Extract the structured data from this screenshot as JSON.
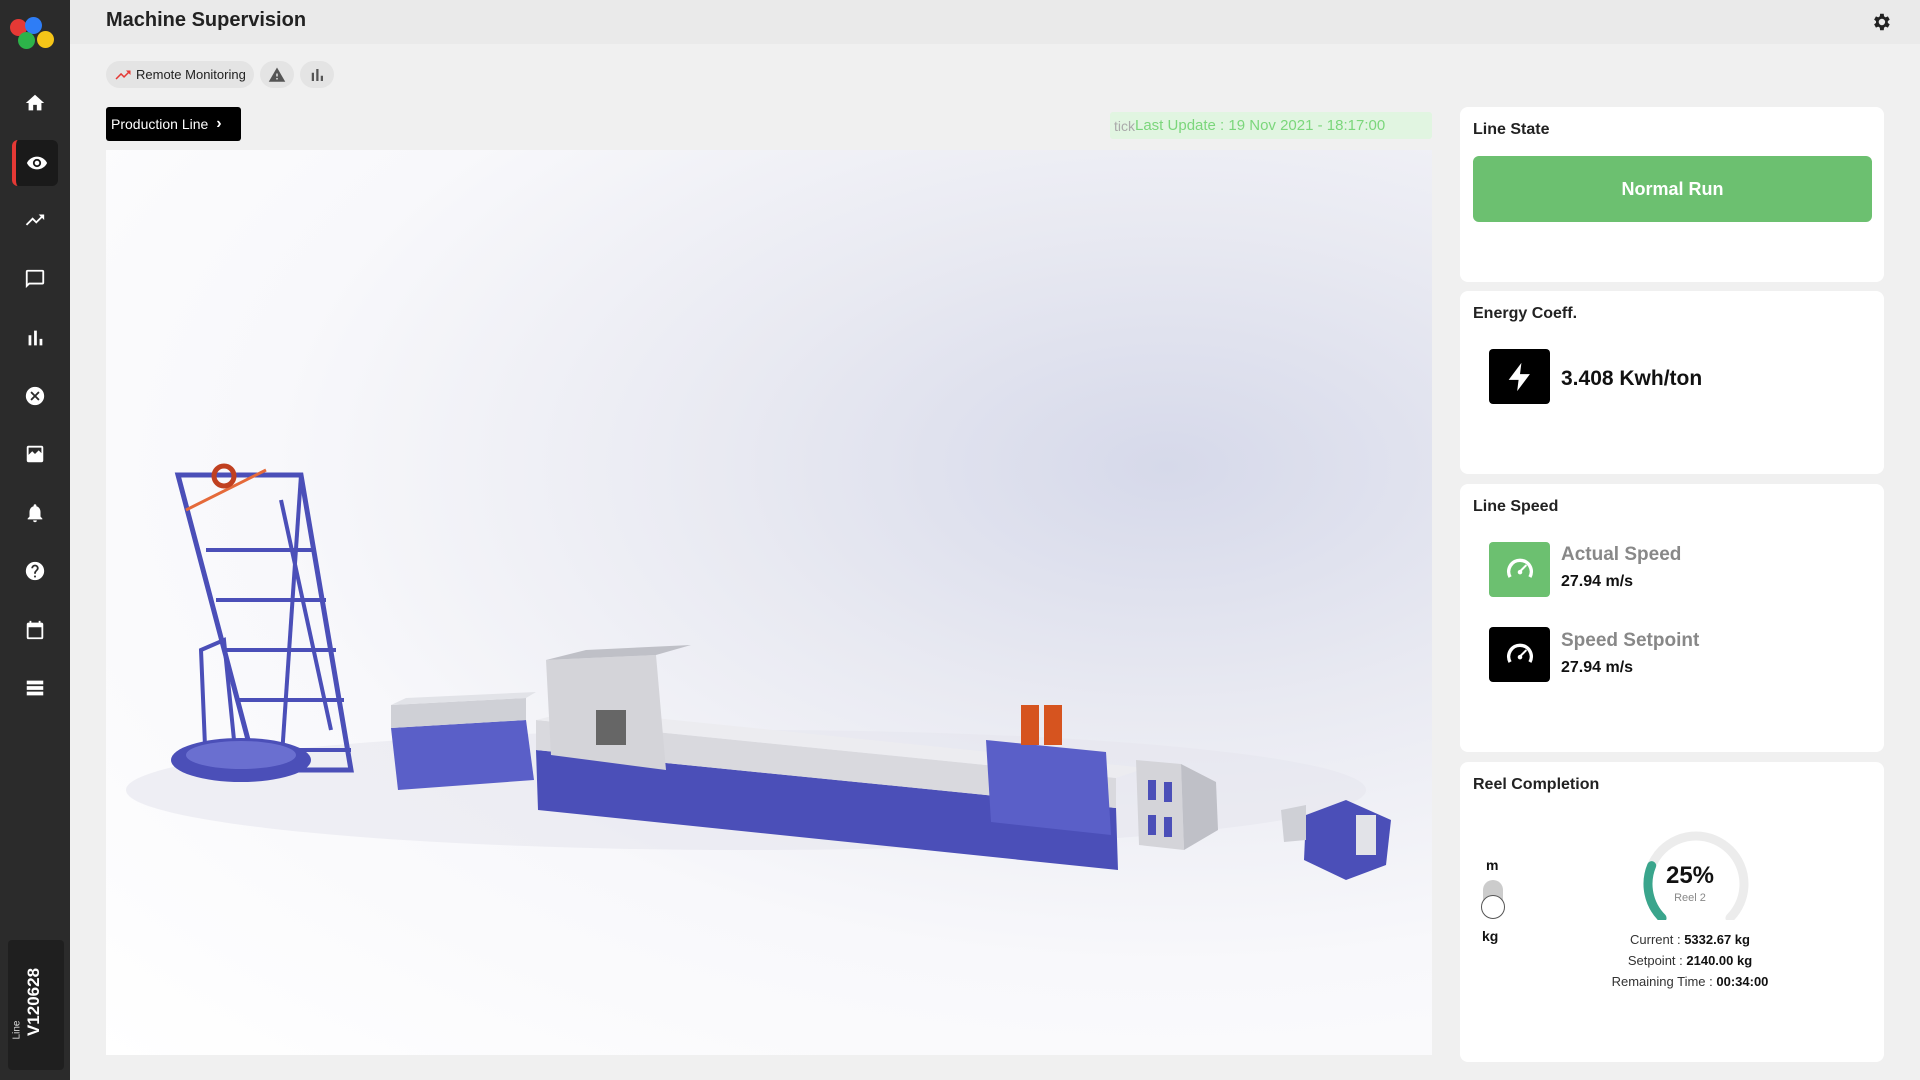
{
  "app": {
    "page_title": "Machine Supervision",
    "line_label": "Line",
    "line_id": "V120628"
  },
  "sidebar": {
    "items": [
      {
        "icon": "home-icon",
        "active": false
      },
      {
        "icon": "eye-icon",
        "active": true
      },
      {
        "icon": "trending-icon",
        "active": false
      },
      {
        "icon": "chat-icon",
        "active": false
      },
      {
        "icon": "bar-chart-icon",
        "active": false
      },
      {
        "icon": "cancel-icon",
        "active": false
      },
      {
        "icon": "image-icon",
        "active": false
      },
      {
        "icon": "bell-icon",
        "active": false
      },
      {
        "icon": "help-icon",
        "active": false
      },
      {
        "icon": "calendar-icon",
        "active": false
      },
      {
        "icon": "list-icon",
        "active": false
      }
    ]
  },
  "tabs": {
    "remote_monitoring": "Remote Monitoring"
  },
  "production": {
    "button_label": "Production Line",
    "tick_alt": "tick",
    "last_update": "Last Update : 19 Nov 2021 - 18:17:00"
  },
  "line_state": {
    "title": "Line State",
    "value": "Normal Run",
    "color": "#6cc070"
  },
  "energy": {
    "title": "Energy Coeff.",
    "value": "3.408 Kwh/ton"
  },
  "line_speed": {
    "title": "Line Speed",
    "actual_label": "Actual Speed",
    "actual_value": "27.94 m/s",
    "setpoint_label": "Speed Setpoint",
    "setpoint_value": "27.94 m/s"
  },
  "reel": {
    "title": "Reel Completion",
    "unit_top": "m",
    "unit_bottom": "kg",
    "percent_value": 25,
    "percent": "25%",
    "reel_name": "Reel 2",
    "current_label": "Current : ",
    "current_value": "5332.67 kg",
    "setpoint_label": "Setpoint : ",
    "setpoint_value": "2140.00 kg",
    "remaining_label": "Remaining Time : ",
    "remaining_value": "00:34:00"
  },
  "colors": {
    "accent_red": "#e53935",
    "green": "#6cc070",
    "gauge_teal": "#3aa58c",
    "machine_blue": "#4b4fb8"
  }
}
